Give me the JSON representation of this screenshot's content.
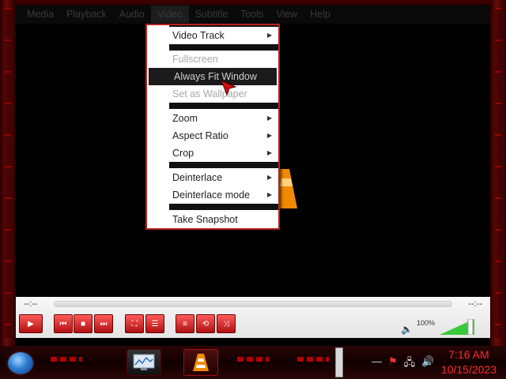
{
  "menubar": {
    "items": [
      "Media",
      "Playback",
      "Audio",
      "Video",
      "Subtitle",
      "Tools",
      "View",
      "Help"
    ],
    "active_index": 3
  },
  "video_menu": {
    "items": [
      {
        "label": "Video Track",
        "submenu": true,
        "disabled": false
      },
      {
        "label": "Fullscreen",
        "submenu": false,
        "disabled": true
      },
      {
        "label": "Always Fit Window",
        "submenu": false,
        "disabled": false,
        "highlighted": true
      },
      {
        "label": "Set as Wallpaper",
        "submenu": false,
        "disabled": true
      },
      {
        "label": "Zoom",
        "submenu": true,
        "disabled": false
      },
      {
        "label": "Aspect Ratio",
        "submenu": true,
        "disabled": false
      },
      {
        "label": "Crop",
        "submenu": true,
        "disabled": false
      },
      {
        "label": "Deinterlace",
        "submenu": true,
        "disabled": false
      },
      {
        "label": "Deinterlace mode",
        "submenu": true,
        "disabled": false
      },
      {
        "label": "Take Snapshot",
        "submenu": false,
        "disabled": false
      }
    ]
  },
  "controls": {
    "elapsed": "--:--",
    "remaining": "--:--",
    "volume_percent_label": "100%",
    "volume_level": 1.0
  },
  "taskbar": {
    "clock_time": "7:16 AM",
    "clock_date": "10/15/2023"
  },
  "colors": {
    "accent_red": "#b5221f",
    "clock_red": "#ff2a2a",
    "volume_green": "#39c93a"
  }
}
